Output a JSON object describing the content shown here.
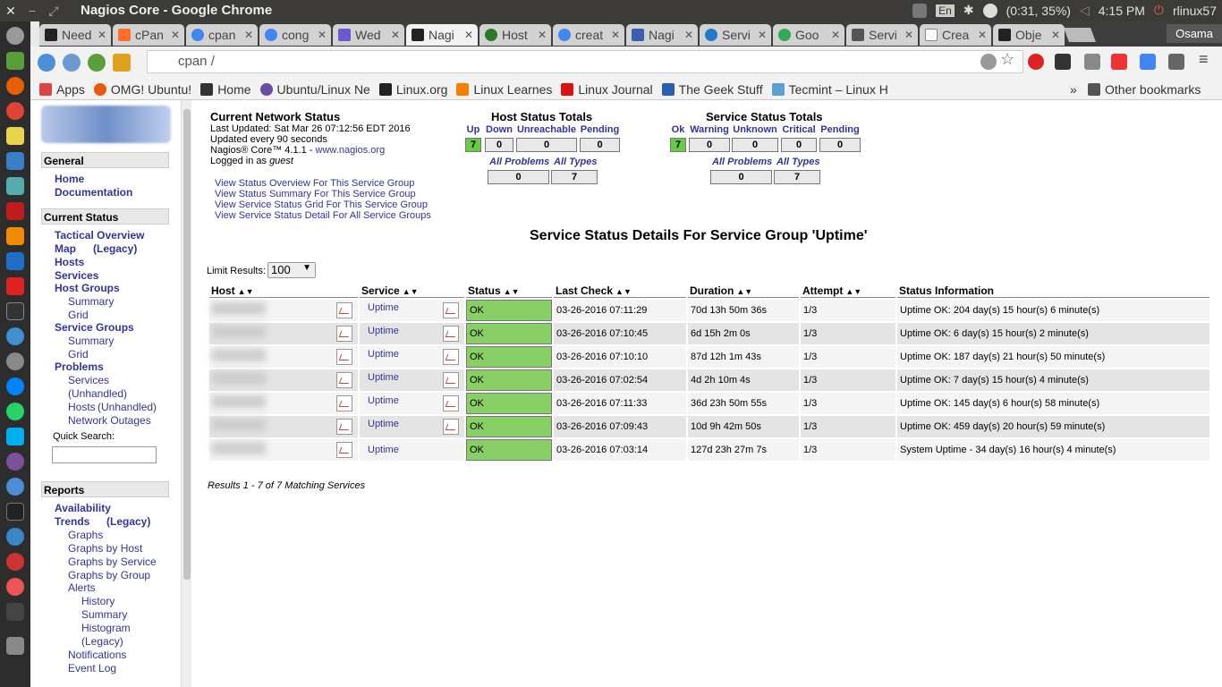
{
  "window": {
    "title": "Nagios Core - Google Chrome",
    "time": "4:15 PM",
    "battery": "(0:31, 35%)",
    "user": "rlinux57",
    "lang": "En"
  },
  "tabs": [
    {
      "label": "Need",
      "active": false
    },
    {
      "label": "cPan",
      "active": false
    },
    {
      "label": "cpan",
      "active": false
    },
    {
      "label": "cong",
      "active": false
    },
    {
      "label": "Wed",
      "active": false
    },
    {
      "label": "Nagi",
      "active": true
    },
    {
      "label": "Host",
      "active": false
    },
    {
      "label": "creat",
      "active": false
    },
    {
      "label": "Nagi",
      "active": false
    },
    {
      "label": "Servi",
      "active": false
    },
    {
      "label": "Goo",
      "active": false
    },
    {
      "label": "Servi",
      "active": false
    },
    {
      "label": "Crea",
      "active": false
    },
    {
      "label": "Obje",
      "active": false
    }
  ],
  "profile": "Osama",
  "url": "cpan                /",
  "bookmarks": [
    "Apps",
    "OMG! Ubuntu!",
    "Home",
    "Ubuntu/Linux Ne",
    "Linux.org",
    "Linux Learnes",
    "Linux Journal",
    "The Geek Stuff",
    "Tecmint – Linux H"
  ],
  "other_bookmarks": "Other bookmarks",
  "more": "»",
  "sidebar": {
    "general": "General",
    "home": "Home",
    "documentation": "Documentation",
    "current_status": "Current Status",
    "tactical": "Tactical Overview",
    "map": "Map",
    "legacy": "(Legacy)",
    "hosts": "Hosts",
    "services": "Services",
    "host_groups": "Host Groups",
    "summary": "Summary",
    "grid": "Grid",
    "service_groups": "Service Groups",
    "problems": "Problems",
    "p_services": "Services",
    "unhandled": "(Unhandled)",
    "p_hosts": "Hosts",
    "unhandled2": "(Unhandled)",
    "outages": "Network Outages",
    "quick_search": "Quick Search:",
    "reports": "Reports",
    "availability": "Availability",
    "trends": "Trends",
    "graphs": "Graphs",
    "graphs_host": "Graphs by Host",
    "graphs_service": "Graphs by Service",
    "graphs_group": "Graphs by Group",
    "alerts": "Alerts",
    "history": "History",
    "a_summary": "Summary",
    "histogram": "Histogram",
    "legacy3": "(Legacy)",
    "notifications": "Notifications",
    "event_log": "Event Log"
  },
  "header": {
    "title": "Current Network Status",
    "updated": "Last Updated: Sat Mar 26 07:12:56 EDT 2016",
    "every": "Updated every 90 seconds",
    "version": "Nagios® Core™ 4.1.1 - ",
    "site": "www.nagios.org",
    "logged": "Logged in as ",
    "user": "guest",
    "links": [
      "View Status Overview For This Service Group",
      "View Status Summary For This Service Group",
      "View Service Status Grid For This Service Group",
      "View Service Status Detail For All Service Groups"
    ]
  },
  "host_totals": {
    "title": "Host Status Totals",
    "labels": [
      "Up",
      "Down",
      "Unreachable",
      "Pending"
    ],
    "values": [
      "7",
      "0",
      "0",
      "0"
    ],
    "all_problems": "All Problems",
    "all_types": "All Types",
    "ap_value": "0",
    "at_value": "7"
  },
  "service_totals": {
    "title": "Service Status Totals",
    "labels": [
      "Ok",
      "Warning",
      "Unknown",
      "Critical",
      "Pending"
    ],
    "values": [
      "7",
      "0",
      "0",
      "0",
      "0"
    ],
    "all_problems": "All Problems",
    "all_types": "All Types",
    "ap_value": "0",
    "at_value": "7"
  },
  "page_title": "Service Status Details For Service Group 'Uptime'",
  "limit_label": "Limit Results:",
  "limit_value": "100",
  "columns": [
    "Host",
    "Service",
    "Status",
    "Last Check",
    "Duration",
    "Attempt",
    "Status Information"
  ],
  "rows": [
    {
      "service": "Uptime",
      "status": "OK",
      "last": "03-26-2016 07:11:29",
      "duration": "70d 13h 50m 36s",
      "attempt": "1/3",
      "info": "Uptime OK: 204 day(s) 15 hour(s) 6 minute(s)"
    },
    {
      "service": "Uptime",
      "status": "OK",
      "last": "03-26-2016 07:10:45",
      "duration": "6d 15h 2m 0s",
      "attempt": "1/3",
      "info": "Uptime OK: 6 day(s) 15 hour(s) 2 minute(s)"
    },
    {
      "service": "Uptime",
      "status": "OK",
      "last": "03-26-2016 07:10:10",
      "duration": "87d 12h 1m 43s",
      "attempt": "1/3",
      "info": "Uptime OK: 187 day(s) 21 hour(s) 50 minute(s)"
    },
    {
      "service": "Uptime",
      "status": "OK",
      "last": "03-26-2016 07:02:54",
      "duration": "4d 2h 10m 4s",
      "attempt": "1/3",
      "info": "Uptime OK: 7 day(s) 15 hour(s) 4 minute(s)"
    },
    {
      "service": "Uptime",
      "status": "OK",
      "last": "03-26-2016 07:11:33",
      "duration": "36d 23h 50m 55s",
      "attempt": "1/3",
      "info": "Uptime OK: 145 day(s) 6 hour(s) 58 minute(s)"
    },
    {
      "service": "Uptime",
      "status": "OK",
      "last": "03-26-2016 07:09:43",
      "duration": "10d 9h 42m 50s",
      "attempt": "1/3",
      "info": "Uptime OK: 459 day(s) 20 hour(s) 59 minute(s)"
    },
    {
      "service": "Uptime",
      "status": "OK",
      "last": "03-26-2016 07:03:14",
      "duration": "127d 23h 27m 7s",
      "attempt": "1/3",
      "info": "System Uptime - 34 day(s) 16 hour(s) 4 minute(s)"
    }
  ],
  "results": "Results 1 - 7 of 7 Matching Services"
}
